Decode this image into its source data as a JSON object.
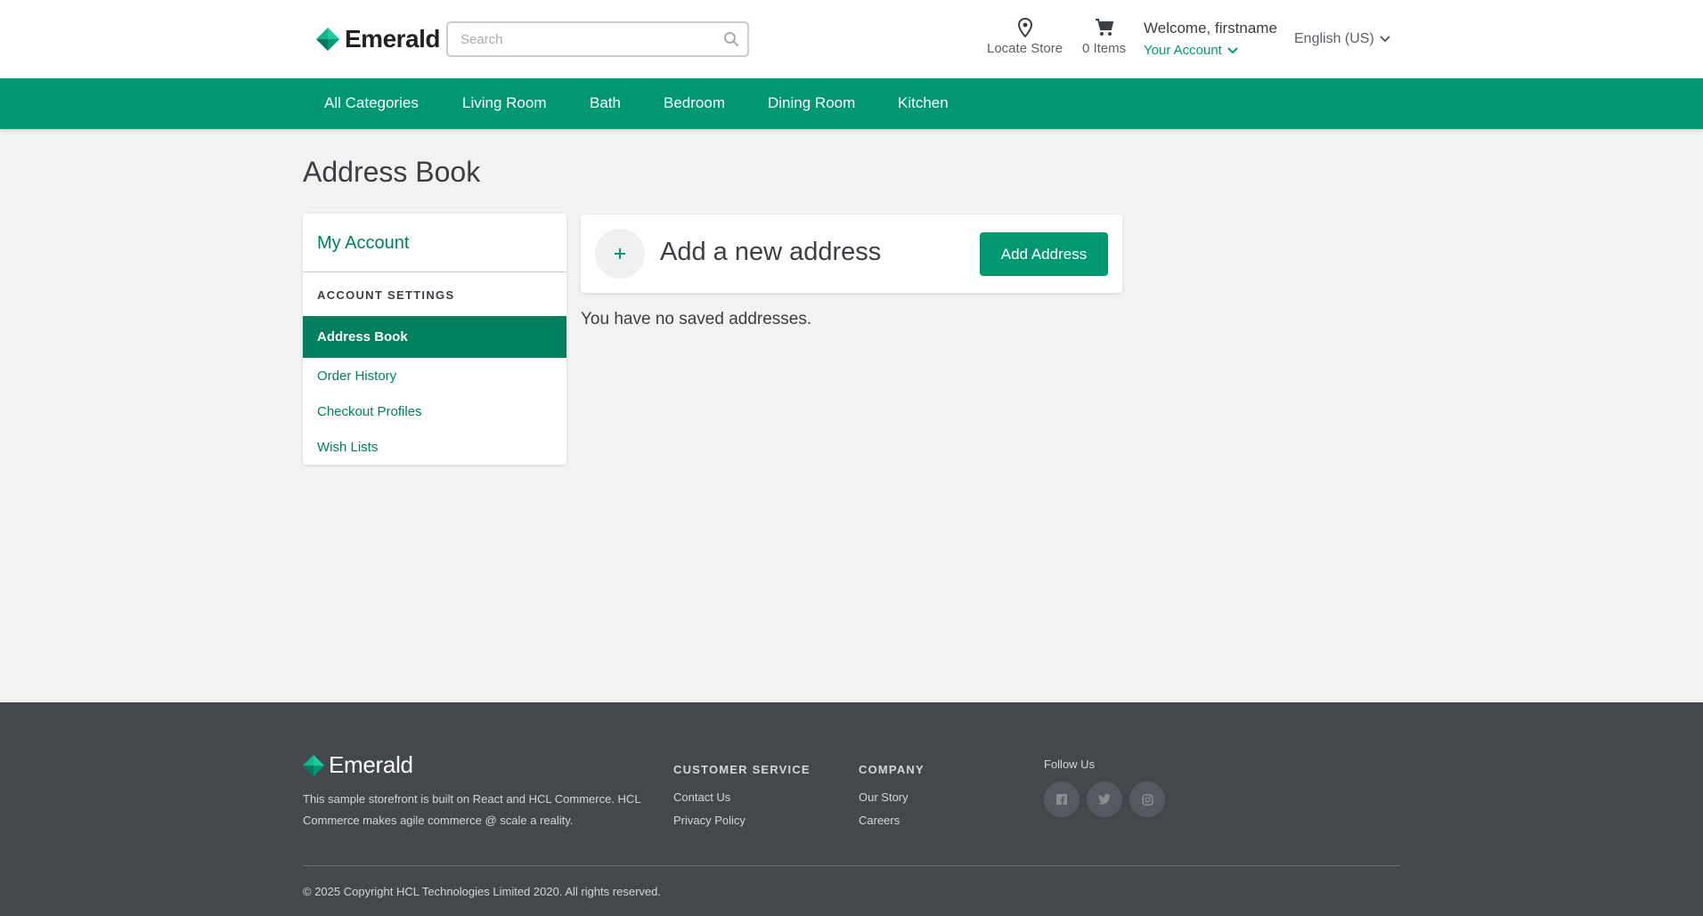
{
  "colors": {
    "brand": "#009873",
    "brand_dark": "#00805e",
    "footer_bg": "#44484d",
    "page_bg": "#f2f2f2"
  },
  "header": {
    "logo_text": "Emerald",
    "search": {
      "placeholder": "Search",
      "value": ""
    },
    "locate_store": "Locate Store",
    "cart": "0 Items",
    "welcome": "Welcome, firstname",
    "your_account": "Your Account",
    "language": "English (US)",
    "icons": {
      "locate": "map-pin-icon",
      "cart": "shopping-cart-icon",
      "search": "search-icon"
    }
  },
  "nav": {
    "items": [
      "All Categories",
      "Living Room",
      "Bath",
      "Bedroom",
      "Dining Room",
      "Kitchen"
    ]
  },
  "main": {
    "page_title": "Address Book",
    "sidebar": {
      "title": "My Account",
      "section": "ACCOUNT SETTINGS",
      "active": "Address Book",
      "links": [
        "Order History",
        "Checkout Profiles",
        "Wish Lists"
      ]
    },
    "add_card": {
      "title": "Add a new address",
      "button": "Add Address",
      "icon": "plus-icon"
    },
    "empty_message": "You have no saved addresses."
  },
  "footer": {
    "logo_text": "Emerald",
    "description": "This sample storefront is built on React and HCL Commerce. HCL Commerce makes agile commerce @ scale a reality.",
    "customer_service": {
      "heading": "CUSTOMER SERVICE",
      "links": [
        "Contact Us",
        "Privacy Policy"
      ]
    },
    "company": {
      "heading": "COMPANY",
      "links": [
        "Our Story",
        "Careers"
      ]
    },
    "follow_us": "Follow Us",
    "social_icons": [
      "facebook-icon",
      "twitter-icon",
      "instagram-icon"
    ],
    "copyright": "© 2025 Copyright HCL Technologies Limited 2020. All rights reserved."
  }
}
